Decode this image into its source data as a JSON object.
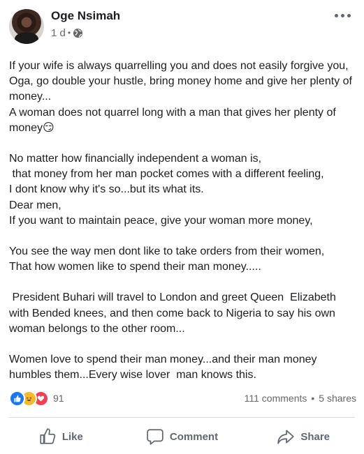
{
  "post": {
    "author": "Oge Nsimah",
    "time": "1 d",
    "paragraphs": [
      "If your wife is always quarrelling you and does not easily forgive you, Oga, go double your hustle, bring money home and give her plenty of money...",
      "A woman does not quarrel long with a man that gives her plenty of money😏",
      "",
      "No matter how financially independent a woman is,",
      " that money from her man pocket comes with a different feeling,",
      "I dont know why it's so...but its what its.",
      "Dear men,",
      "If you want to maintain peace, give your woman more money,",
      "",
      "You see the way men dont like to take orders from their women,",
      "That how women like to spend their man money.....",
      "",
      " President Buhari will travel to London and greet Queen  Elizabeth with Bended knees, and then come back to Nigeria to say his own woman belongs to the other room...",
      "",
      "Women love to spend their man money...and their man money humbles them...Every wise lover  man knows this."
    ]
  },
  "reactions": {
    "icons": [
      "like-icon",
      "haha-icon",
      "love-icon"
    ],
    "count": "91",
    "comments": "111 comments",
    "separator": "•",
    "shares": "5 shares"
  },
  "actions": {
    "like": "Like",
    "comment": "Comment",
    "share": "Share"
  },
  "colors": {
    "like_blue": "#1877f2",
    "haha_yellow": "#f7b928",
    "love_red": "#f33e58",
    "secondary_text": "#65676b"
  }
}
